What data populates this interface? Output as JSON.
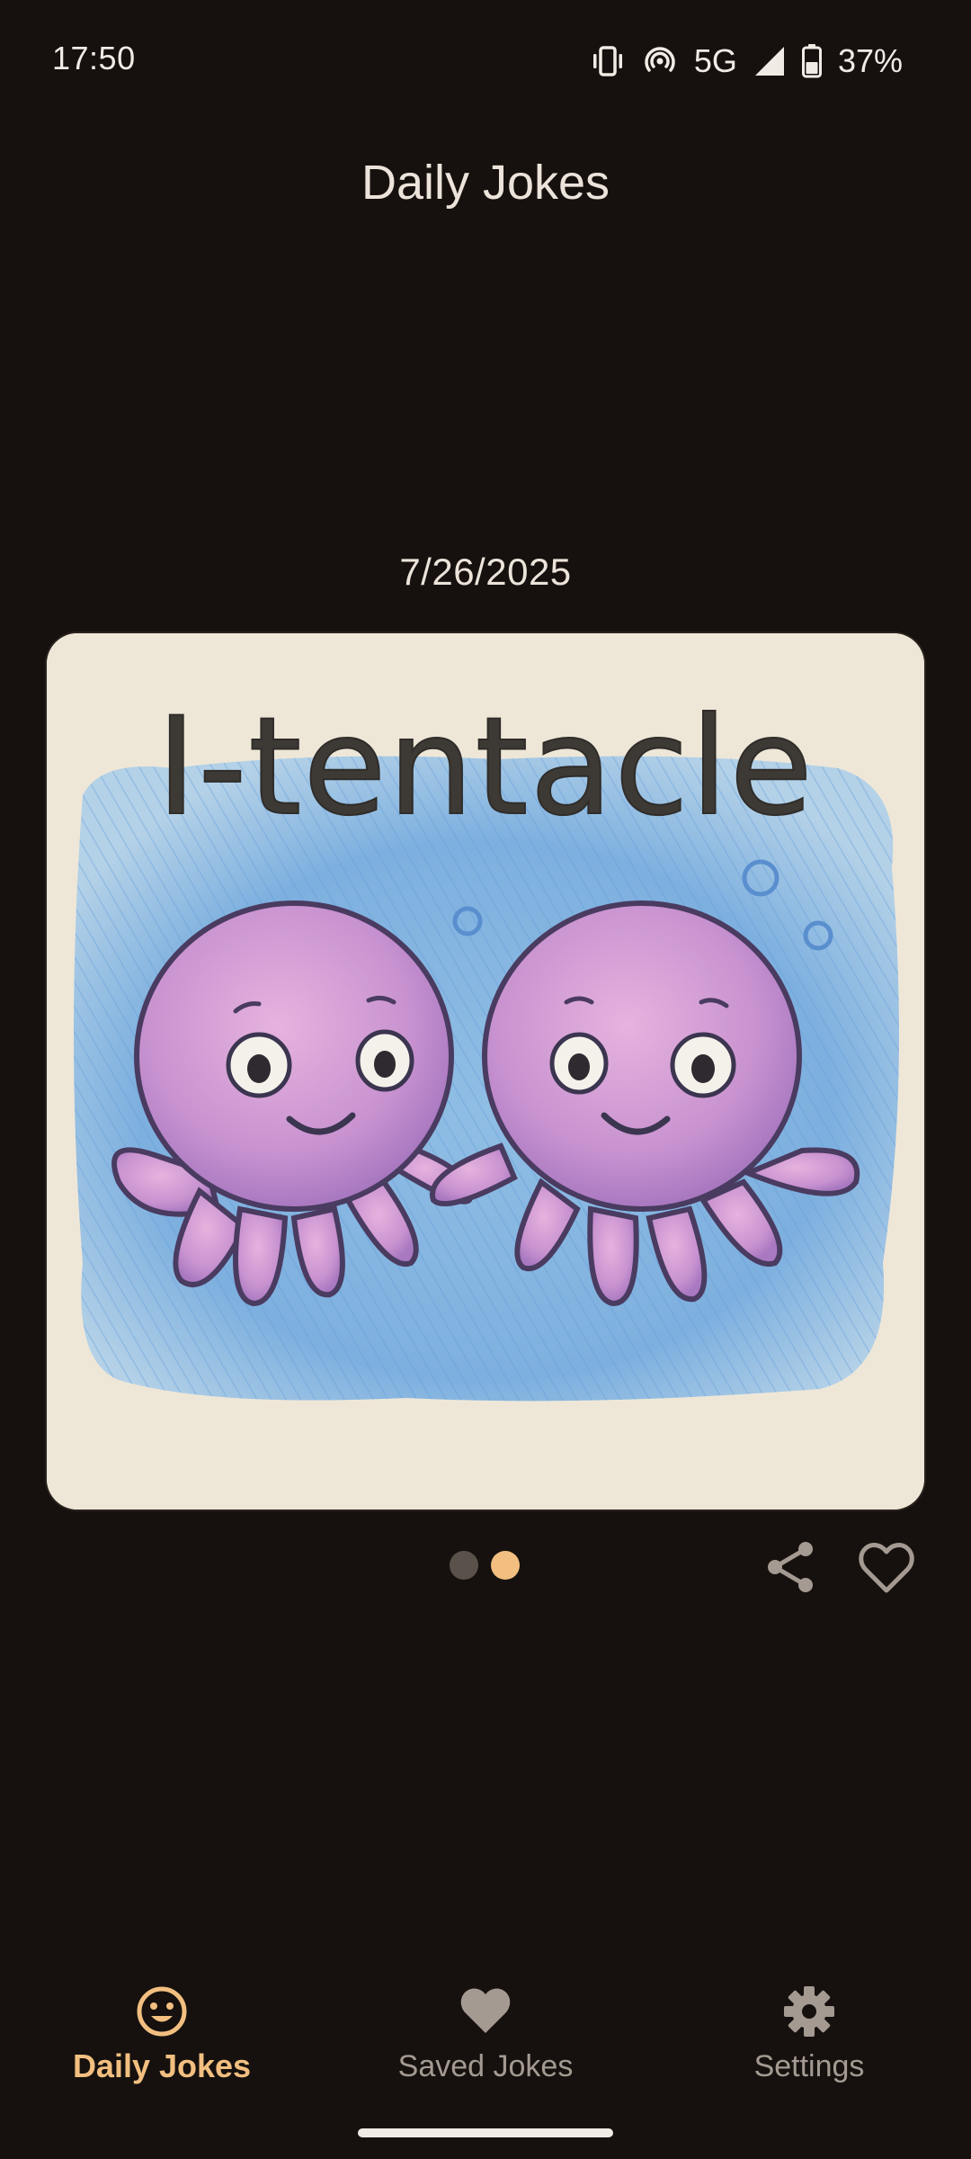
{
  "status_bar": {
    "time": "17:50",
    "network": "5G",
    "battery": "37%",
    "icons": [
      "vibrate-icon",
      "hotspot-icon",
      "signal-icon",
      "battery-icon"
    ]
  },
  "app": {
    "title": "Daily Jokes"
  },
  "joke": {
    "date": "7/26/2025",
    "image_text": "I-tentacle",
    "page_count": 2,
    "current_page": 2
  },
  "actions": {
    "share_icon": "share-icon",
    "favorite_icon": "heart-outline-icon"
  },
  "bottom_nav": {
    "items": [
      {
        "label": "Daily Jokes",
        "icon": "smiley-icon",
        "active": true
      },
      {
        "label": "Saved Jokes",
        "icon": "heart-icon",
        "active": false
      },
      {
        "label": "Settings",
        "icon": "gear-icon",
        "active": false
      }
    ]
  },
  "colors": {
    "background": "#16110e",
    "accent": "#f2bf80",
    "inactive": "#a49a92",
    "card": "#eee7d8"
  }
}
